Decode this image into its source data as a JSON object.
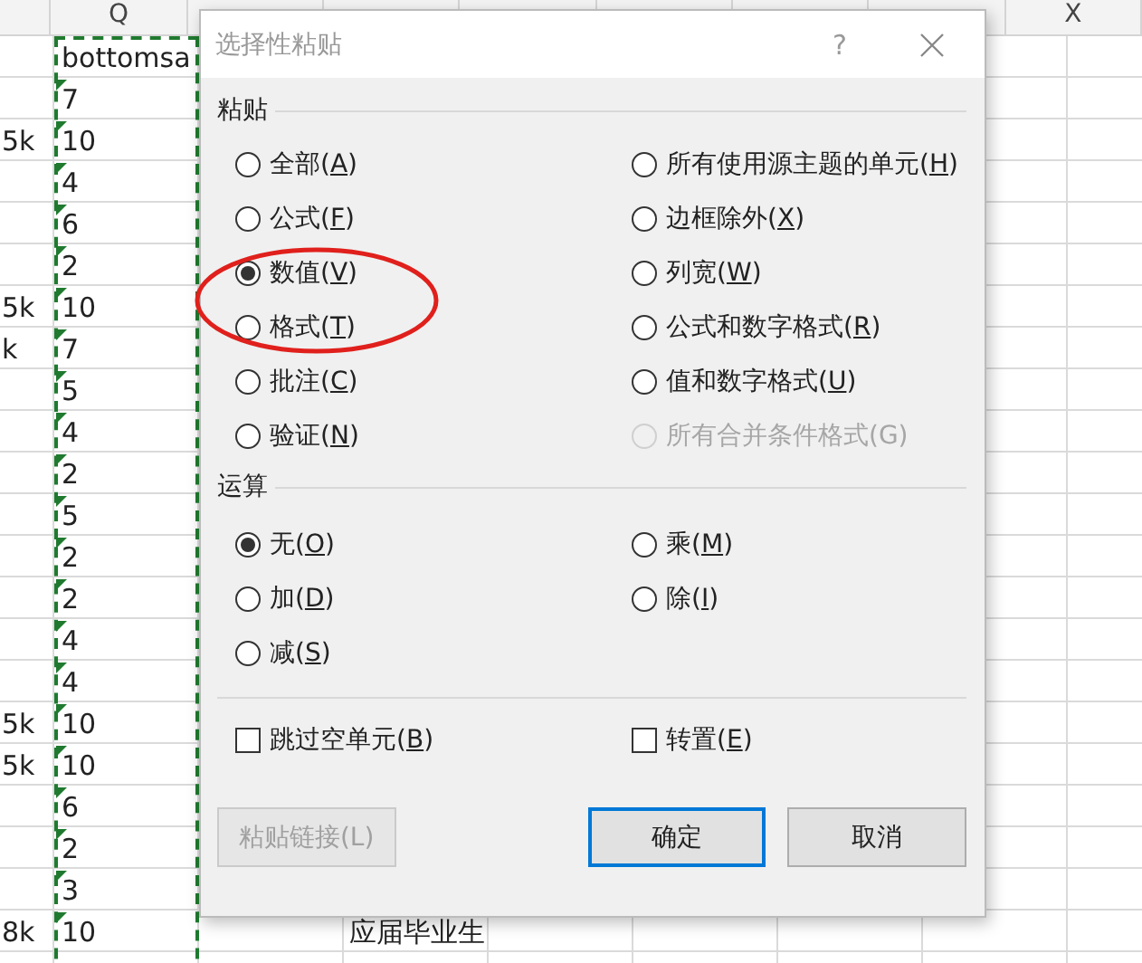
{
  "spreadsheet": {
    "columns": [
      "Q",
      "X"
    ],
    "rows": [
      {
        "q": "bottomsa",
        "q_flagged": false
      },
      {
        "q": "7",
        "q_flagged": true
      },
      {
        "p": "5k",
        "q": "10",
        "q_flagged": true
      },
      {
        "q": "4",
        "q_flagged": true
      },
      {
        "q": "6",
        "q_flagged": true
      },
      {
        "q": "2",
        "q_flagged": true
      },
      {
        "p": "5k",
        "q": "10",
        "q_flagged": true
      },
      {
        "p": "k",
        "q": "7",
        "q_flagged": true
      },
      {
        "q": "5",
        "q_flagged": true
      },
      {
        "q": "4",
        "q_flagged": true
      },
      {
        "q": "2",
        "q_flagged": true
      },
      {
        "q": "5",
        "q_flagged": true
      },
      {
        "q": "2",
        "q_flagged": true
      },
      {
        "q": "2",
        "q_flagged": true
      },
      {
        "q": "4",
        "q_flagged": true
      },
      {
        "q": "4",
        "q_flagged": true
      },
      {
        "p": "5k",
        "q": "10",
        "q_flagged": true
      },
      {
        "p": "5k",
        "q": "10",
        "q_flagged": true
      },
      {
        "q": "6",
        "q_flagged": true
      },
      {
        "q": "2",
        "q_flagged": true
      },
      {
        "q": "3",
        "q_flagged": true
      },
      {
        "p": "8k",
        "q": "10",
        "q_flagged": true,
        "s": "应届毕业生"
      }
    ]
  },
  "dialog": {
    "title": "选择性粘贴",
    "help": "?",
    "paste": {
      "label": "粘贴",
      "options": [
        {
          "label": "全部(A)",
          "selected": false,
          "disabled": false,
          "access_key": true
        },
        {
          "label": "所有使用源主题的单元(H)",
          "selected": false,
          "disabled": false,
          "access_key": true
        },
        {
          "label": "公式(F)",
          "selected": false,
          "disabled": false,
          "access_key": true
        },
        {
          "label": "边框除外(X)",
          "selected": false,
          "disabled": false,
          "access_key": true
        },
        {
          "label": "数值(V)",
          "selected": true,
          "disabled": false,
          "access_key": true
        },
        {
          "label": "列宽(W)",
          "selected": false,
          "disabled": false,
          "access_key": true
        },
        {
          "label": "格式(T)",
          "selected": false,
          "disabled": false,
          "access_key": true
        },
        {
          "label": "公式和数字格式(R)",
          "selected": false,
          "disabled": false,
          "access_key": true
        },
        {
          "label": "批注(C)",
          "selected": false,
          "disabled": false,
          "access_key": true
        },
        {
          "label": "值和数字格式(U)",
          "selected": false,
          "disabled": false,
          "access_key": true
        },
        {
          "label": "验证(N)",
          "selected": false,
          "disabled": false,
          "access_key": true
        },
        {
          "label": "所有合并条件格式(G)",
          "selected": false,
          "disabled": true,
          "access_key": false
        }
      ]
    },
    "operation": {
      "label": "运算",
      "options": [
        {
          "label": "无(O)",
          "selected": true,
          "disabled": false,
          "access_key": true
        },
        {
          "label": "乘(M)",
          "selected": false,
          "disabled": false,
          "access_key": true
        },
        {
          "label": "加(D)",
          "selected": false,
          "disabled": false,
          "access_key": true
        },
        {
          "label": "除(I)",
          "selected": false,
          "disabled": false,
          "access_key": true
        },
        {
          "label": "减(S)",
          "selected": false,
          "disabled": false,
          "access_key": true
        }
      ]
    },
    "checkboxes": [
      {
        "label": "跳过空单元(B)",
        "checked": false,
        "access_key": true
      },
      {
        "label": "转置(E)",
        "checked": false,
        "access_key": true
      }
    ],
    "buttons": [
      {
        "label": "粘贴链接(L)",
        "disabled": true,
        "default": false
      },
      {
        "label": "确定",
        "disabled": false,
        "default": true
      },
      {
        "label": "取消",
        "disabled": false,
        "default": false
      }
    ]
  }
}
